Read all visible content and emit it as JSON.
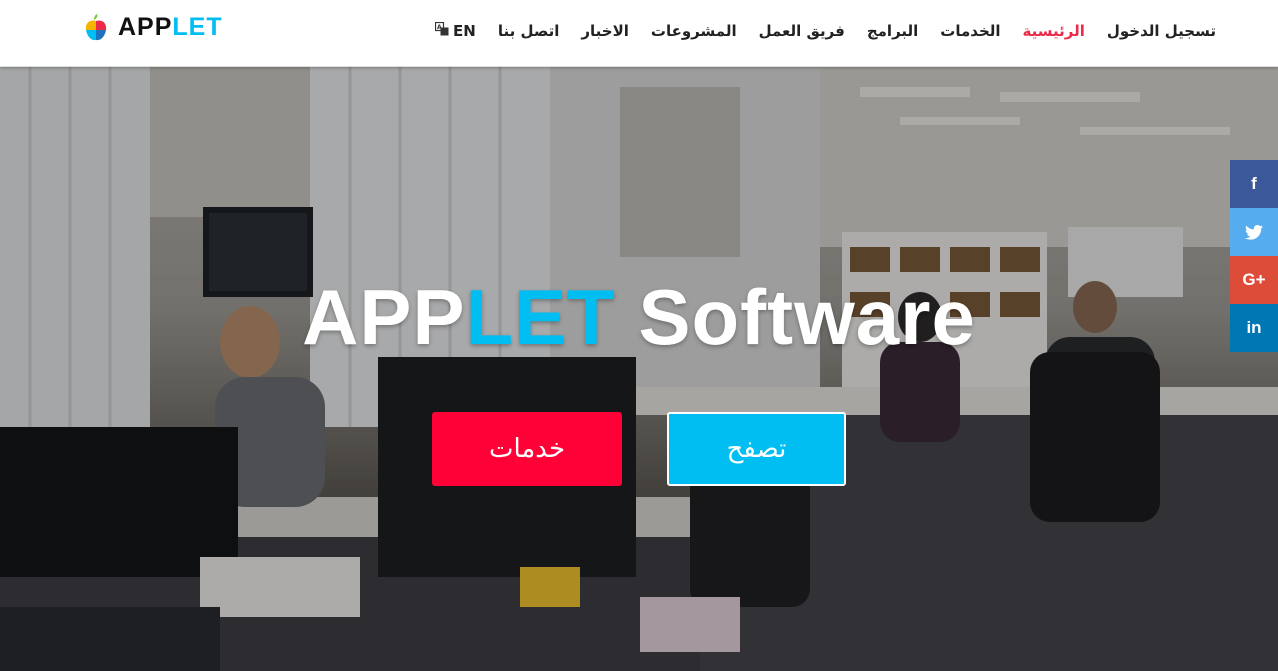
{
  "logo": {
    "part1": "APP",
    "part2": "LET"
  },
  "nav": {
    "items": [
      {
        "label": "تسجيل الدخول",
        "active": false
      },
      {
        "label": "الرئيسية",
        "active": true
      },
      {
        "label": "الخدمات",
        "active": false
      },
      {
        "label": "البرامج",
        "active": false
      },
      {
        "label": "فريق العمل",
        "active": false
      },
      {
        "label": "المشروعات",
        "active": false
      },
      {
        "label": "الاخبار",
        "active": false
      },
      {
        "label": "اتصل بنا",
        "active": false
      }
    ],
    "language": "EN",
    "language_icon": "translate-icon"
  },
  "hero": {
    "title_part1": "APP",
    "title_part2": "LET",
    "title_part3": "Software",
    "services_button": "خدمات",
    "browse_button": "تصفح"
  },
  "social": {
    "facebook": "f",
    "twitter": "twitter-icon",
    "googleplus": "G+",
    "linkedin": "in"
  },
  "colors": {
    "accent": "#00bdf2",
    "primary_red": "#ff0037",
    "active_nav": "#ec2b4b"
  }
}
